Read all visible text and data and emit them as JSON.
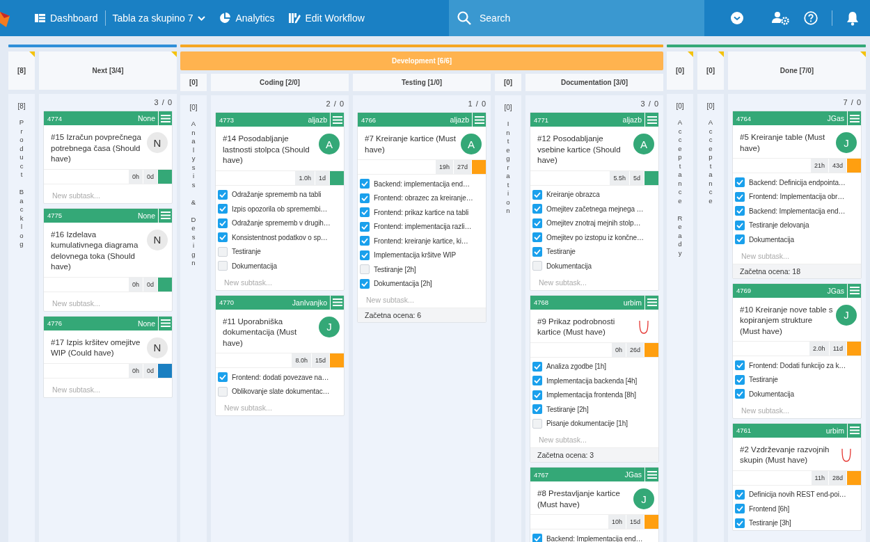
{
  "topbar": {
    "nav": [
      {
        "kind": "dashboard",
        "label": "Dashboard"
      },
      {
        "kind": "dropdown",
        "label": "Tabla za skupino 7"
      },
      {
        "kind": "analytics",
        "label": "Analytics"
      },
      {
        "kind": "workflow",
        "label": "Edit Workflow"
      }
    ],
    "search": {
      "placeholder": "Search"
    }
  },
  "board": {
    "groups": [
      {
        "color": "#2f8fd8",
        "columns": [
          {
            "kind": "collapsed",
            "flagged": true,
            "header": "[8]",
            "count": "[8]",
            "name": "Product Backlog"
          },
          {
            "kind": "open",
            "flagged": true,
            "header": "Next [3/4]",
            "tally": "3 / 0",
            "cards": [
              {
                "id": "4774",
                "owner": "None",
                "title": "#15 Izračun povprečnega potrebnega časa (Should have)",
                "avatar": {
                  "kind": "unassigned",
                  "letter": "N"
                },
                "hours": "0h",
                "days": "0d",
                "color": "#34a877",
                "placeholder": "New subtask..."
              },
              {
                "id": "4775",
                "owner": "None",
                "title": "#16 Izdelava kumulativnega diagrama delovnega toka (Should have)",
                "avatar": {
                  "kind": "unassigned",
                  "letter": "N"
                },
                "hours": "0h",
                "days": "0d",
                "color": "#34a877",
                "placeholder": "New subtask..."
              },
              {
                "id": "4776",
                "owner": "None",
                "title": "#17 Izpis kršitev omejitve WIP (Could have)",
                "avatar": {
                  "kind": "unassigned",
                  "letter": "N"
                },
                "hours": "0h",
                "days": "0d",
                "color": "#1a7fc1",
                "placeholder": "New subtask..."
              }
            ]
          }
        ]
      },
      {
        "color": "#f5a623",
        "title": "Development [6/6]",
        "columns": [
          {
            "kind": "collapsed",
            "flagged": false,
            "header": "[0]",
            "count": "[0]",
            "name": "Analysis & Design"
          },
          {
            "kind": "open",
            "flagged": false,
            "header": "Coding [2/0]",
            "tally": "2 / 0",
            "cards": [
              {
                "id": "4773",
                "owner": "aljazb",
                "title": "#14 Posodabljanje lastnosti stolpca (Should have)",
                "avatar": {
                  "kind": "user",
                  "letter": "A"
                },
                "hours": "1.0h",
                "days": "1d",
                "color": "#34a877",
                "subtasks": [
                  {
                    "label": "Odražanje sprememb na tabli",
                    "checked": true
                  },
                  {
                    "label": "Izpis opozorila ob spremembi…",
                    "checked": true
                  },
                  {
                    "label": "Odražanje sprememb v drugih…",
                    "checked": true
                  },
                  {
                    "label": "Konsistentnost podatkov o sp…",
                    "checked": true
                  },
                  {
                    "label": "Testiranje",
                    "checked": false
                  },
                  {
                    "label": "Dokumentacija",
                    "checked": false
                  }
                ],
                "placeholder": "New subtask..."
              },
              {
                "id": "4770",
                "owner": "JanIvanjko",
                "title": "#11 Uporabniška dokumentacija (Must have)",
                "avatar": {
                  "kind": "user",
                  "letter": "J"
                },
                "hours": "8.0h",
                "days": "15d",
                "color": "#ff9f10",
                "subtasks": [
                  {
                    "label": "Frontend: dodati povezave na…",
                    "checked": true
                  },
                  {
                    "label": "Oblikovanje slate dokumentac…",
                    "checked": false
                  }
                ],
                "placeholder": "New subtask..."
              }
            ]
          },
          {
            "kind": "open",
            "flagged": false,
            "header": "Testing [1/0]",
            "tally": "1 / 0",
            "cards": [
              {
                "id": "4766",
                "owner": "aljazb",
                "title": "#7 Kreiranje kartice (Must have)",
                "avatar": {
                  "kind": "user",
                  "letter": "A"
                },
                "hours": "19h",
                "days": "27d",
                "color": "#ff9f10",
                "subtasks": [
                  {
                    "label": "Backend: implementacija end…",
                    "checked": true
                  },
                  {
                    "label": "Frontend: obrazec za kreiranje…",
                    "checked": true
                  },
                  {
                    "label": "Frontend: prikaz kartice na tabli",
                    "checked": true
                  },
                  {
                    "label": "Frontend: implementacija razli…",
                    "checked": true
                  },
                  {
                    "label": "Frontend: kreiranje kartice, ki…",
                    "checked": true
                  },
                  {
                    "label": "Implementacija kršitve WIP",
                    "checked": true
                  },
                  {
                    "label": "Testiranje [2h]",
                    "checked": false
                  },
                  {
                    "label": "Dokumentacija [2h]",
                    "checked": true
                  }
                ],
                "placeholder": "New subtask...",
                "estimate": "Začetna ocena: 6"
              }
            ]
          },
          {
            "kind": "collapsed",
            "flagged": false,
            "header": "[0]",
            "count": "[0]",
            "name": "Integration"
          },
          {
            "kind": "open",
            "flagged": false,
            "header": "Documentation [3/0]",
            "tally": "3 / 0",
            "cards": [
              {
                "id": "4771",
                "owner": "aljazb",
                "title": "#12 Posodabljanje vsebine kartice (Should have)",
                "avatar": {
                  "kind": "user",
                  "letter": "A"
                },
                "hours": "5.5h",
                "days": "5d",
                "color": "#34a877",
                "subtasks": [
                  {
                    "label": "Kreiranje obrazca",
                    "checked": true
                  },
                  {
                    "label": "Omejitev začetnega mejnega …",
                    "checked": true
                  },
                  {
                    "label": "Omejitev znotraj mejnih stolp…",
                    "checked": true
                  },
                  {
                    "label": "Omejitev po izstopu iz končne…",
                    "checked": true
                  },
                  {
                    "label": "Testiranje",
                    "checked": true
                  },
                  {
                    "label": "Dokumentacija",
                    "checked": false
                  }
                ],
                "placeholder": "New subtask..."
              },
              {
                "id": "4768",
                "owner": "urbim",
                "title": "#9 Prikaz podrobnosti kartice (Must have)",
                "avatar": {
                  "kind": "picture"
                },
                "hours": "0h",
                "days": "26d",
                "color": "#ff9f10",
                "subtasks": [
                  {
                    "label": "Analiza zgodbe [1h]",
                    "checked": true
                  },
                  {
                    "label": "Implementacija backenda [4h]",
                    "checked": true
                  },
                  {
                    "label": "Implementacija frontenda [8h]",
                    "checked": true
                  },
                  {
                    "label": "Testiranje [2h]",
                    "checked": true
                  },
                  {
                    "label": "Pisanje dokumentacije [1h]",
                    "checked": false
                  }
                ],
                "placeholder": "New subtask...",
                "estimate": "Začetna ocena: 3"
              },
              {
                "id": "4767",
                "owner": "JGas",
                "title": "#8 Prestavljanje kartice (Must have)",
                "avatar": {
                  "kind": "user",
                  "letter": "J"
                },
                "hours": "10h",
                "days": "15d",
                "color": "#ff9f10",
                "subtasks": [
                  {
                    "label": "Backend: Implementacija end…",
                    "checked": true
                  }
                ]
              }
            ]
          }
        ]
      },
      {
        "color": "#34a877",
        "columns": [
          {
            "kind": "collapsed",
            "flagged": true,
            "header": "[0]",
            "count": "[0]",
            "name": "Acceptance Ready"
          },
          {
            "kind": "collapsed",
            "flagged": true,
            "header": "[0]",
            "count": "[0]",
            "name": "Acceptance"
          },
          {
            "kind": "open",
            "flagged": true,
            "header": "Done [7/0]",
            "tally": "7 / 0",
            "cards": [
              {
                "id": "4764",
                "owner": "JGas",
                "title": "#5 Kreiranje table (Must have)",
                "avatar": {
                  "kind": "user",
                  "letter": "J"
                },
                "hours": "21h",
                "days": "43d",
                "color": "#ff9f10",
                "subtasks": [
                  {
                    "label": "Backend: Definicija endpointa…",
                    "checked": true
                  },
                  {
                    "label": "Frontend: Implementacija obr…",
                    "checked": true
                  },
                  {
                    "label": "Backend: Implementacija end…",
                    "checked": true
                  },
                  {
                    "label": "Testiranje delovanja",
                    "checked": true
                  },
                  {
                    "label": "Dokumentacija",
                    "checked": true
                  }
                ],
                "placeholder": "New subtask...",
                "estimate": "Začetna ocena: 18"
              },
              {
                "id": "4769",
                "owner": "JGas",
                "title": "#10 Kreiranje nove table s kopiranjem strukture (Must have)",
                "avatar": {
                  "kind": "user",
                  "letter": "J"
                },
                "hours": "2.0h",
                "days": "11d",
                "color": "#ff9f10",
                "subtasks": [
                  {
                    "label": "Frontend: Dodati funkcijo za k…",
                    "checked": true
                  },
                  {
                    "label": "Testiranje",
                    "checked": true
                  },
                  {
                    "label": "Dokumentacija",
                    "checked": true
                  }
                ],
                "placeholder": "New subtask..."
              },
              {
                "id": "4761",
                "owner": "urbim",
                "title": "#2 Vzdrževanje razvojnih skupin (Must have)",
                "avatar": {
                  "kind": "picture"
                },
                "hours": "11h",
                "days": "28d",
                "color": "#ff9f10",
                "subtasks": [
                  {
                    "label": "Definicija novih REST end-poi…",
                    "checked": true
                  },
                  {
                    "label": "Frontend [6h]",
                    "checked": true
                  },
                  {
                    "label": "Testiranje [3h]",
                    "checked": true
                  }
                ]
              }
            ]
          }
        ]
      }
    ]
  }
}
